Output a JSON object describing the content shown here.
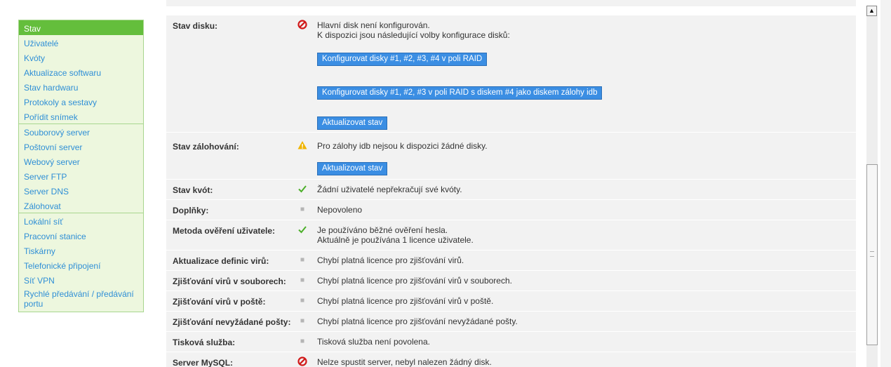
{
  "sidebar": {
    "groups": [
      [
        {
          "label": "Stav",
          "active": true
        },
        {
          "label": "Uživatelé"
        },
        {
          "label": "Kvóty"
        },
        {
          "label": "Aktualizace softwaru"
        },
        {
          "label": "Stav hardwaru"
        },
        {
          "label": "Protokoly a sestavy"
        },
        {
          "label": "Pořídit snímek"
        }
      ],
      [
        {
          "label": "Souborový server"
        },
        {
          "label": "Poštovní server"
        },
        {
          "label": "Webový server"
        },
        {
          "label": "Server FTP"
        },
        {
          "label": "Server DNS"
        },
        {
          "label": "Zálohovat"
        }
      ],
      [
        {
          "label": "Lokální síť"
        },
        {
          "label": "Pracovní stanice"
        },
        {
          "label": "Tiskárny"
        },
        {
          "label": "Telefonické připojení"
        },
        {
          "label": "Síť VPN"
        },
        {
          "label": "Rychlé předávání / předávání portu"
        }
      ]
    ]
  },
  "status": {
    "disk": {
      "label": "Stav disku:",
      "icon": "error-icon",
      "line1": "Hlavní disk není konfigurován.",
      "line2": "K dispozici jsou následující volby konfigurace disků:",
      "btn1": "Konfigurovat disky #1, #2, #3, #4 v poli RAID",
      "btn2": "Konfigurovat disky #1, #2, #3 v poli RAID s diskem #4 jako diskem zálohy idb",
      "btn3": "Aktualizovat stav"
    },
    "backup": {
      "label": "Stav zálohování:",
      "icon": "warning-icon",
      "line1": "Pro zálohy idb nejsou k dispozici žádné disky.",
      "btn": "Aktualizovat stav"
    },
    "quota": {
      "label": "Stav kvót:",
      "icon": "check-icon",
      "value": "Žádní uživatelé nepřekračují své kvóty."
    },
    "addons": {
      "label": "Doplňky:",
      "icon": "bullet-icon",
      "value": "Nepovoleno"
    },
    "auth": {
      "label": "Metoda ověření uživatele:",
      "icon": "check-icon",
      "line1": "Je používáno běžné ověření hesla.",
      "line2": "Aktuálně je používána 1 licence uživatele."
    },
    "virus_defs": {
      "label": "Aktualizace definic virů:",
      "icon": "bullet-icon",
      "value": "Chybí platná licence pro zjišťování virů."
    },
    "virus_files": {
      "label": "Zjišťování virů v souborech:",
      "icon": "bullet-icon",
      "value": "Chybí platná licence pro zjišťování virů v souborech."
    },
    "virus_mail": {
      "label": "Zjišťování virů v poště:",
      "icon": "bullet-icon",
      "value": "Chybí platná licence pro zjišťování virů v poště."
    },
    "spam": {
      "label": "Zjišťování nevyžádané pošty:",
      "icon": "bullet-icon",
      "value": "Chybí platná licence pro zjišťování nevyžádané pošty."
    },
    "print": {
      "label": "Tisková služba:",
      "icon": "bullet-icon",
      "value": "Tisková služba není povolena."
    },
    "mysql": {
      "label": "Server MySQL:",
      "icon": "error-icon",
      "value": "Nelze spustit server, nebyl nalezen žádný disk."
    }
  },
  "colors": {
    "nav_text": "#2f8fd6",
    "nav_active_bg": "#64be3c",
    "sidebar_bg": "#edf7de",
    "button_bg": "#3b8ee3",
    "error": "#d11a1a",
    "warning": "#f0b400",
    "check": "#4caf2a",
    "bullet": "#b5b5b5"
  }
}
